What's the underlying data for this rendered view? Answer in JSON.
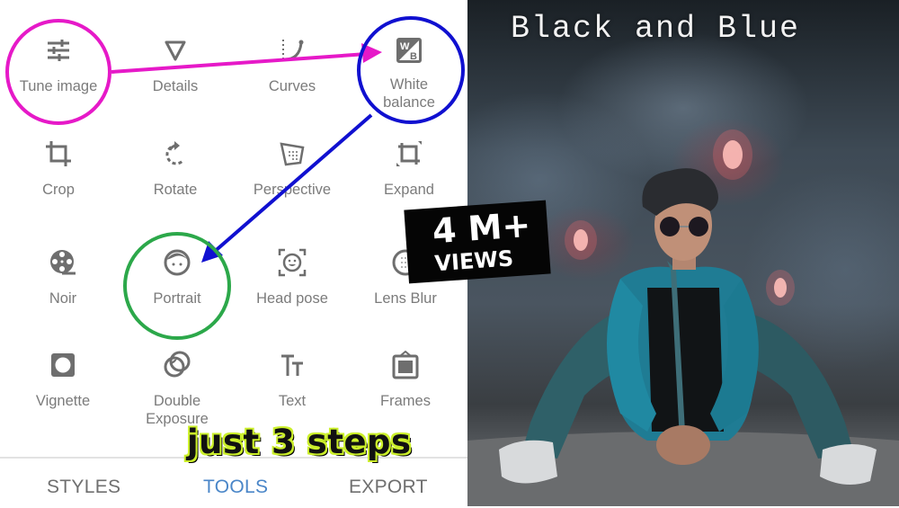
{
  "editor": {
    "tools": [
      {
        "label": "Tune image",
        "icon": "tune-sliders-icon"
      },
      {
        "label": "Details",
        "icon": "details-triangle-icon"
      },
      {
        "label": "Curves",
        "icon": "curves-icon"
      },
      {
        "label": "White balance",
        "icon": "white-balance-icon"
      },
      {
        "label": "Crop",
        "icon": "crop-icon"
      },
      {
        "label": "Rotate",
        "icon": "rotate-icon"
      },
      {
        "label": "Perspective",
        "icon": "perspective-icon"
      },
      {
        "label": "Expand",
        "icon": "expand-icon"
      },
      {
        "label": "Noir",
        "icon": "film-reel-icon"
      },
      {
        "label": "Portrait",
        "icon": "face-icon"
      },
      {
        "label": "Head pose",
        "icon": "head-pose-icon"
      },
      {
        "label": "Lens Blur",
        "icon": "lens-blur-icon"
      },
      {
        "label": "Vignette",
        "icon": "vignette-icon"
      },
      {
        "label": "Double Exposure",
        "icon": "double-exposure-icon"
      },
      {
        "label": "Text",
        "icon": "text-icon"
      },
      {
        "label": "Frames",
        "icon": "frames-icon"
      }
    ],
    "tabs": [
      {
        "label": "STYLES",
        "active": false
      },
      {
        "label": "TOOLS",
        "active": true
      },
      {
        "label": "EXPORT",
        "active": false
      }
    ],
    "white_balance_icon_letters": {
      "top": "W",
      "bottom": "B"
    },
    "text_icon_glyph": "Tт"
  },
  "annotations": {
    "circle_colors": {
      "tune_image": "#e619c8",
      "white_balance": "#1010d0",
      "portrait": "#2ca84a"
    },
    "arrow_colors": {
      "step1": "#e619c8",
      "step2": "#1010d0"
    },
    "steps_caption": "just 3 steps"
  },
  "thumbnail": {
    "title": "Black and Blue",
    "badge_big": "4 M+",
    "badge_small": "VIEWS"
  },
  "colors": {
    "active_tab": "#4a86c8",
    "inactive_text": "#7b7b7b"
  }
}
